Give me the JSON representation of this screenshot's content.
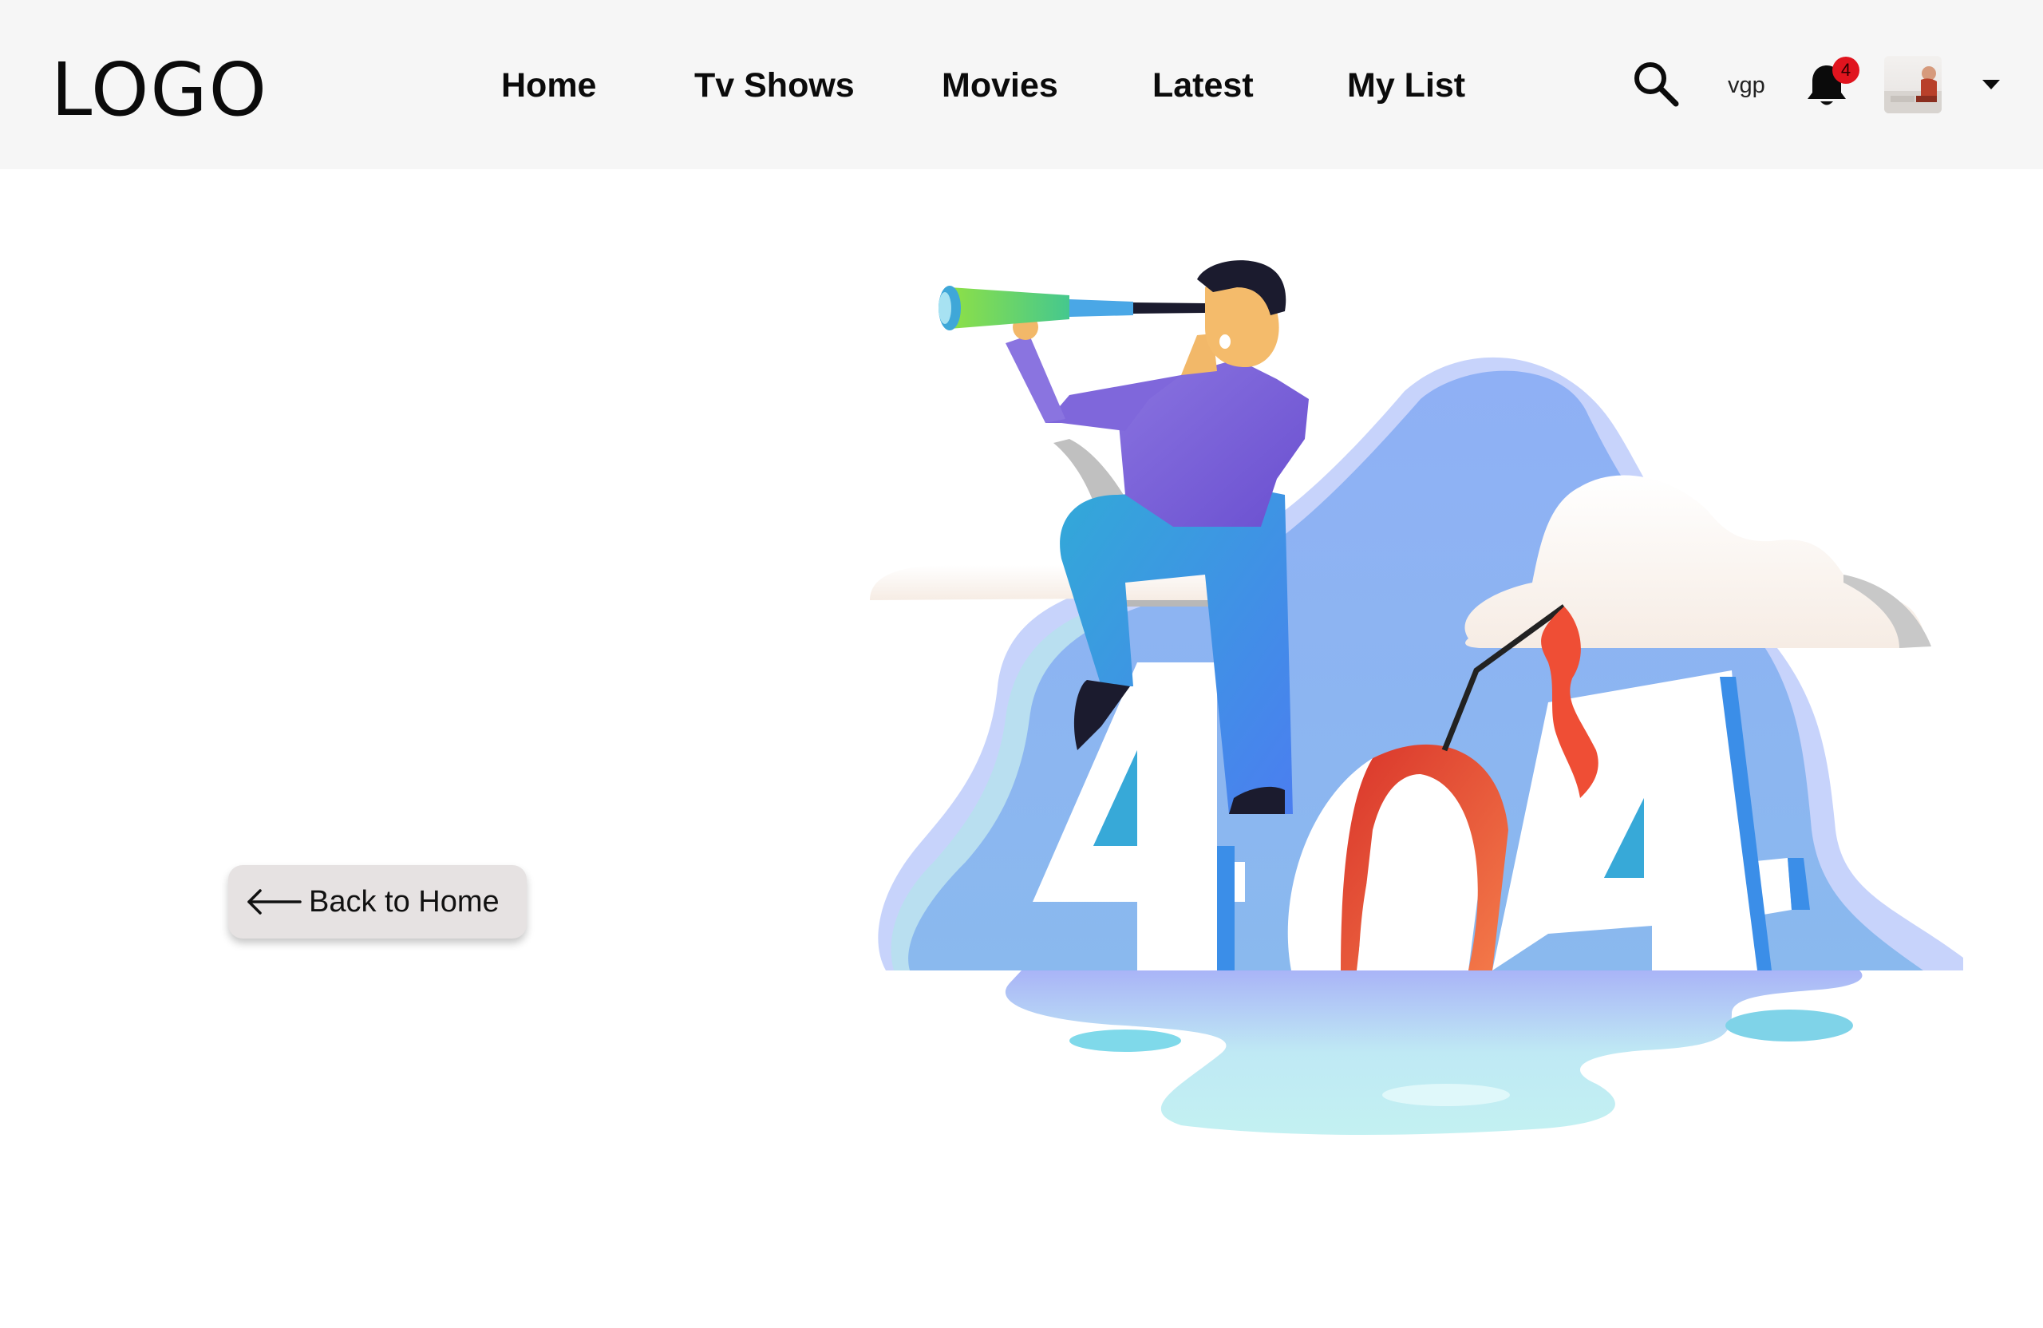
{
  "header": {
    "logo_text": "LOGO",
    "nav": [
      {
        "label": "Home"
      },
      {
        "label": "Tv Shows"
      },
      {
        "label": "Movies"
      },
      {
        "label": "Latest"
      },
      {
        "label": "My List"
      }
    ],
    "username": "vgp",
    "notification_count": "4",
    "icons": {
      "search": "search-icon",
      "bell": "bell-icon",
      "avatar": "user-avatar",
      "dropdown": "caret-down-icon"
    }
  },
  "main": {
    "back_button": {
      "label": "Back to Home",
      "icon": "arrow-left-icon"
    },
    "illustration": {
      "text": "404",
      "description_icon": "lost-404-illustration"
    }
  },
  "colors": {
    "header_bg": "#f6f6f6",
    "badge": "#e0141e",
    "button_bg": "#e6e2e2",
    "blob": "#8db9f0",
    "shirt": "#7b62d6",
    "pants": "#3a9be0"
  }
}
